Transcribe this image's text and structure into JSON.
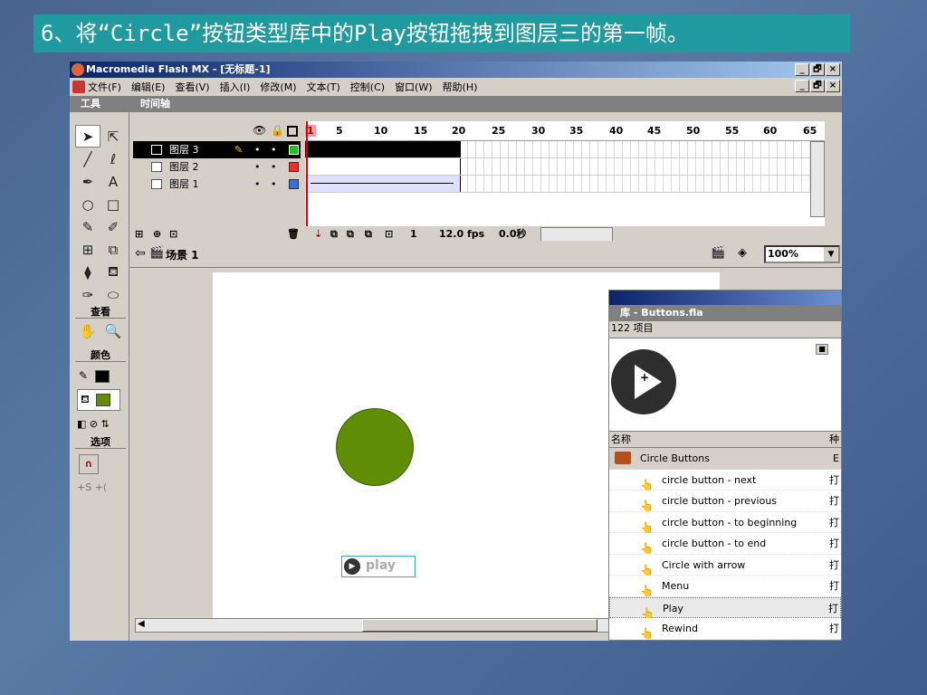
{
  "slide_title": "6、将“Circle”按钮类型库中的Play按钮拖拽到图层三的第一帧。",
  "window": {
    "title": "Macromedia Flash MX - [无标题-1]",
    "min": "_",
    "max": "🗗",
    "close": "×"
  },
  "menu": [
    "文件(F)",
    "编辑(E)",
    "查看(V)",
    "插入(I)",
    "修改(M)",
    "文本(T)",
    "控制(C)",
    "窗口(W)",
    "帮助(H)"
  ],
  "tools_panel": {
    "title": "工具",
    "view_label": "查看",
    "colors_label": "颜色",
    "options_label": "选项",
    "tools": [
      "arrow-tool",
      "subselect-tool",
      "line-tool",
      "lasso-tool",
      "pen-tool",
      "text-tool",
      "oval-tool",
      "rect-tool",
      "pencil-tool",
      "brush-tool",
      "free-transform-tool",
      "fill-transform-tool",
      "ink-bottle-tool",
      "paint-bucket-tool",
      "dropper-tool",
      "eraser-tool"
    ],
    "tool_glyphs": [
      "➤",
      "⇱",
      "╱",
      "ℓ",
      "✒",
      "A",
      "○",
      "□",
      "✎",
      "✐",
      "⊞",
      "⧉",
      "⧫",
      "⛾",
      "✑",
      "⬭"
    ],
    "view_glyphs": [
      "✋",
      "🔍"
    ],
    "stroke_color": "#000000",
    "fill_color": "#5f8e06"
  },
  "timeline": {
    "title": "时间轴",
    "layers": [
      {
        "name": "图层 3",
        "active": true,
        "color": "#22c022"
      },
      {
        "name": "图层 2",
        "active": false,
        "color": "#e83030"
      },
      {
        "name": "图层 1",
        "active": false,
        "color": "#3a6ee0"
      }
    ],
    "ruler": [
      "1",
      "5",
      "10",
      "15",
      "20",
      "25",
      "30",
      "35",
      "40",
      "45",
      "50",
      "55",
      "60",
      "65"
    ],
    "current_frame": "1",
    "fps": "12.0 fps",
    "time": "0.0秒"
  },
  "edit_bar": {
    "scene": "场景 1",
    "zoom": "100%"
  },
  "stage": {
    "play_button_label": "play",
    "circle_color": "#5f8e06"
  },
  "library": {
    "title": "库 - Buttons.fla",
    "item_count": "122 项目",
    "column_name": "名称",
    "column_kind": "种",
    "items": [
      {
        "name": "Circle Buttons",
        "folder": true,
        "kind": "E"
      },
      {
        "name": "circle button - next",
        "folder": false,
        "kind": "打"
      },
      {
        "name": "circle button - previous",
        "folder": false,
        "kind": "打"
      },
      {
        "name": "circle button - to beginning",
        "folder": false,
        "kind": "打"
      },
      {
        "name": "circle button - to end",
        "folder": false,
        "kind": "打"
      },
      {
        "name": "Circle with arrow",
        "folder": false,
        "kind": "打"
      },
      {
        "name": "Menu",
        "folder": false,
        "kind": "打"
      },
      {
        "name": "Play",
        "folder": false,
        "kind": "打",
        "selected": true
      },
      {
        "name": "Rewind",
        "folder": false,
        "kind": "打"
      }
    ]
  }
}
